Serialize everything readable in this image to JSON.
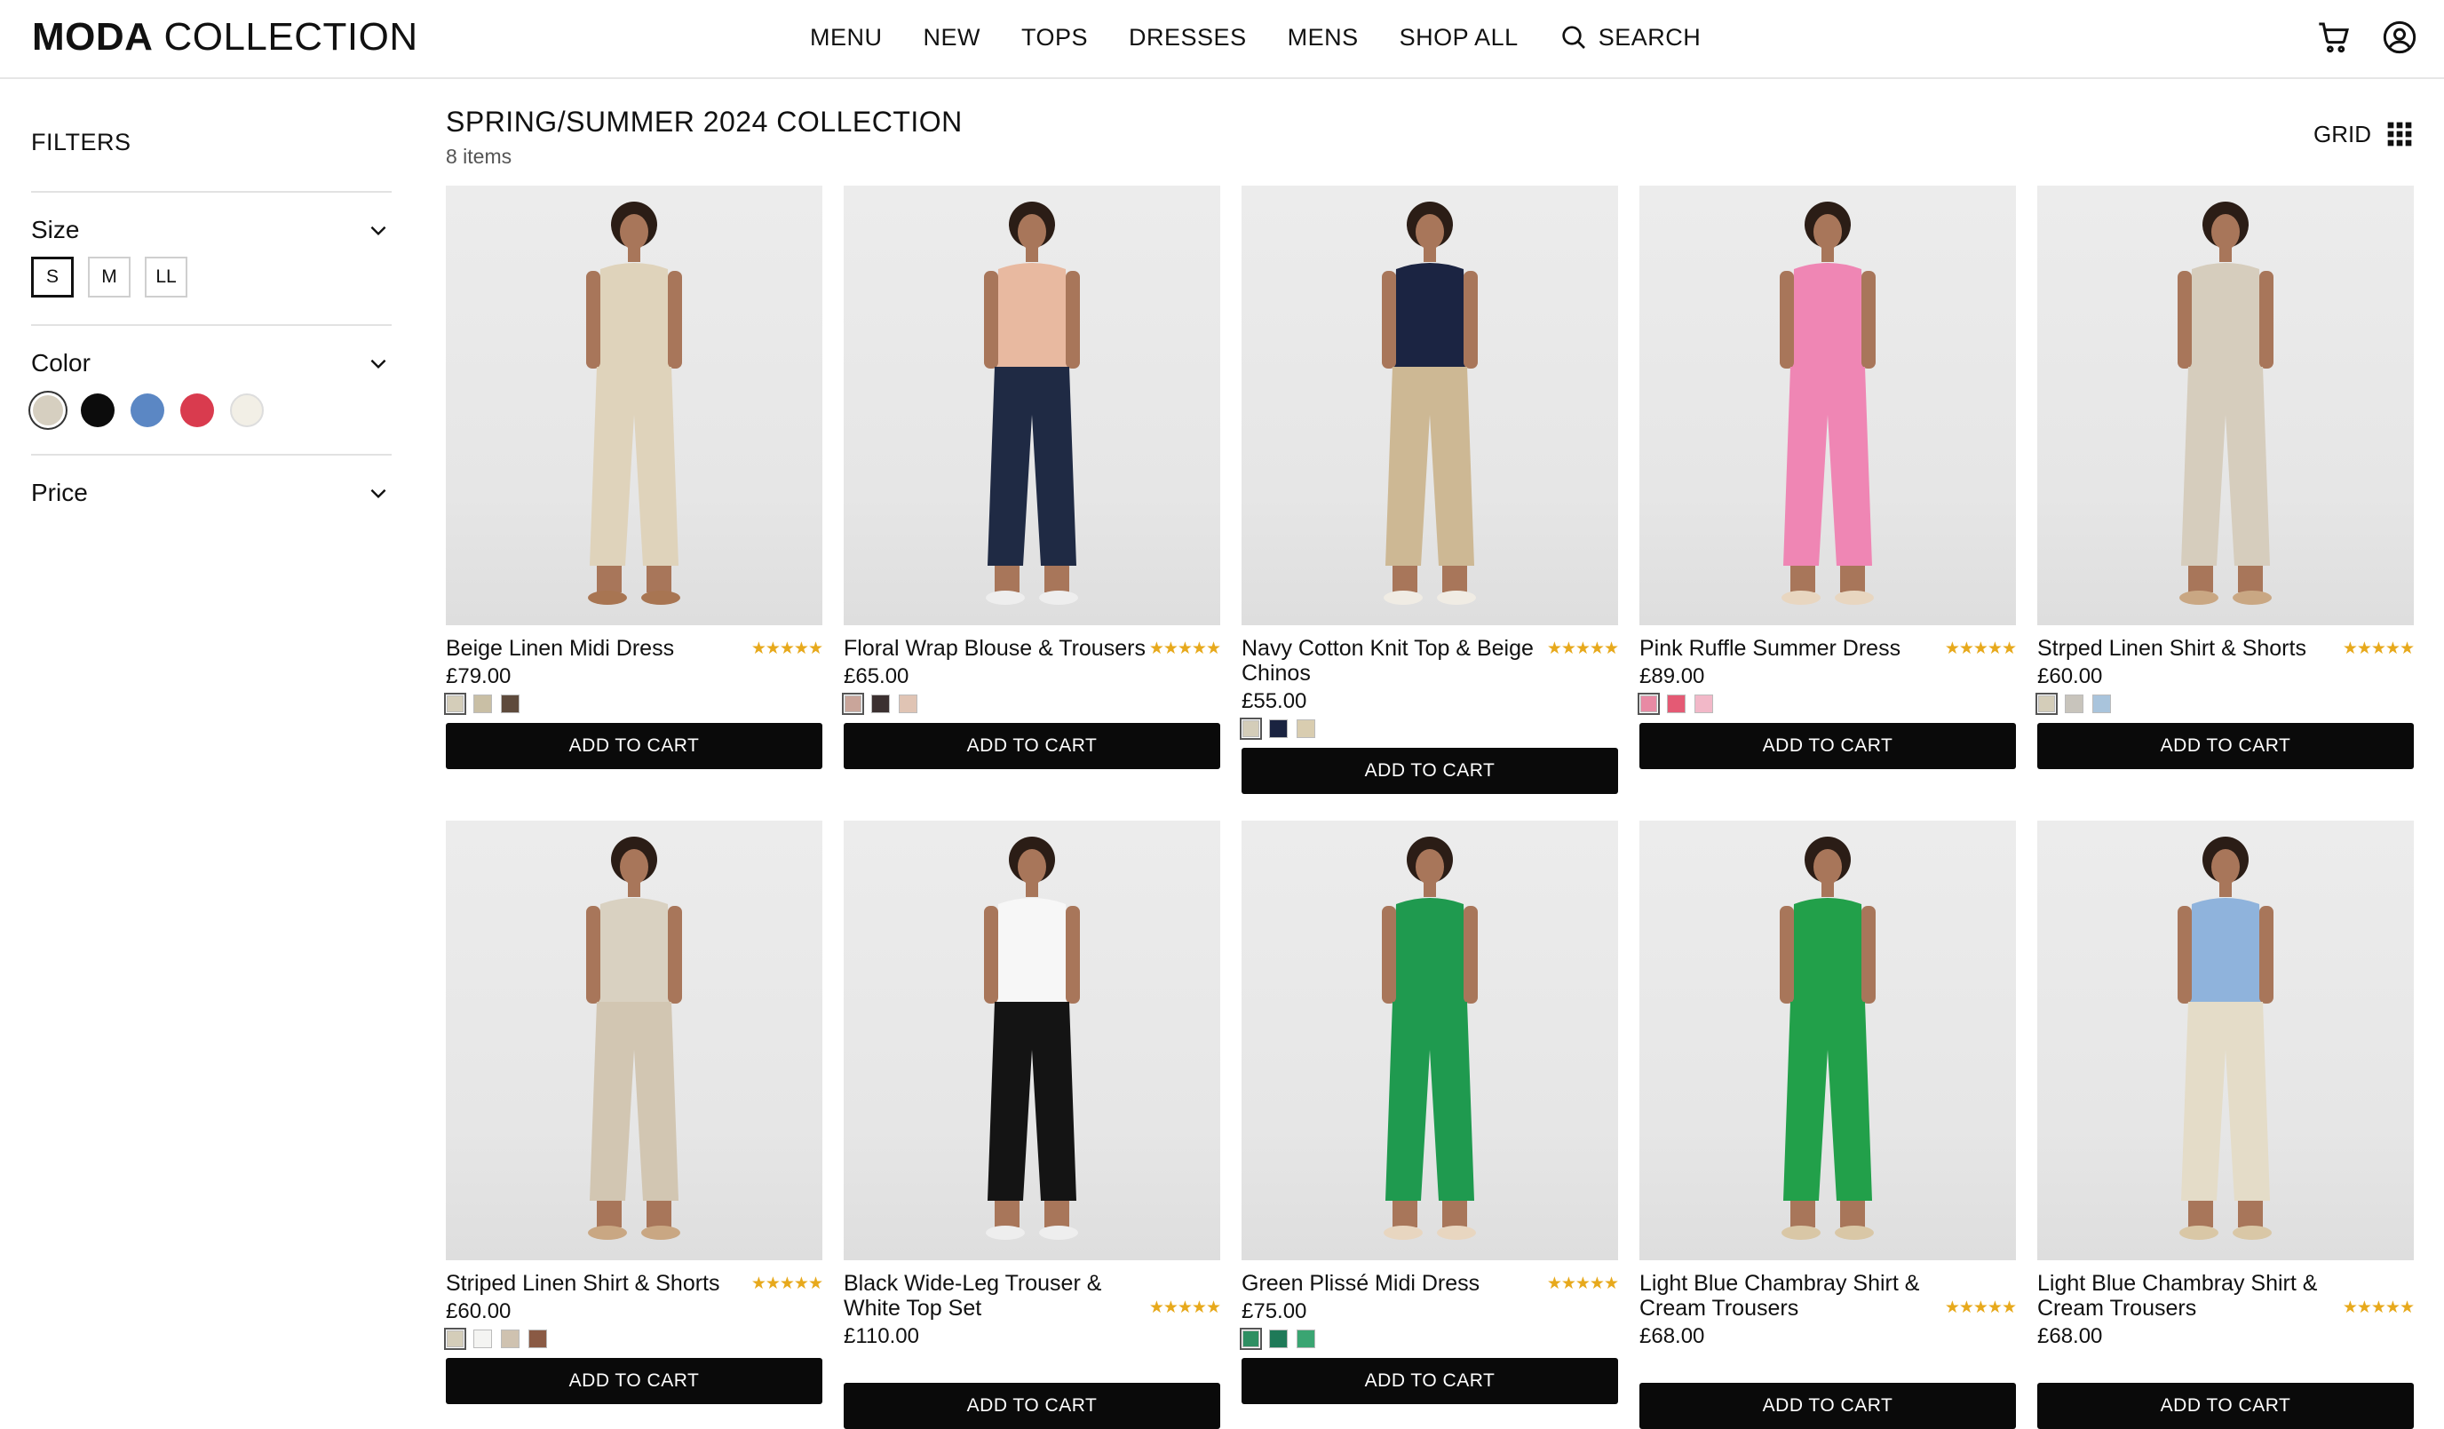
{
  "header": {
    "logo_bold": "MODA",
    "logo_regular": "COLLECTION",
    "nav": [
      "MENU",
      "NEW",
      "TOPS",
      "DRESSES",
      "MENS",
      "SHOP ALL"
    ],
    "search_label": "SEARCH",
    "icons": [
      "search-icon",
      "cart-icon",
      "account-icon"
    ]
  },
  "sidebar": {
    "title": "FILTERS",
    "size_label": "Size",
    "sizes": [
      "S",
      "M",
      "LL"
    ],
    "selected_size": "S",
    "color_label": "Color",
    "colors": [
      "#d6cfc0",
      "#0c0c0c",
      "#5b87c4",
      "#d93b4e",
      "#f2efe6"
    ],
    "selected_color": "#d6cfc0",
    "price_label": "Price"
  },
  "main": {
    "title": "SPRING/SUMMER 2024 COLLECTION",
    "count": "8 items",
    "view_label": "GRID",
    "cart_label": "ADD TO CART",
    "rating_stars": "★★★★★",
    "products": [
      {
        "name": "Beige Linen Midi Dress",
        "price": "£79.00",
        "rating": 5,
        "swatches": [
          "#d4cdb9",
          "#c9bfa5",
          "#5e4a3c"
        ],
        "top": "#dfd3bb",
        "bottom": "#dfd3bb",
        "shoes": "#a87552"
      },
      {
        "name": "Floral Wrap Blouse & Trousers",
        "price": "£65.00",
        "rating": 5,
        "swatches": [
          "#c9a59a",
          "#3b3030",
          "#e0c4b4"
        ],
        "top": "#e8b9a0",
        "bottom": "#1f2a44",
        "shoes": "#eeeeee"
      },
      {
        "name": "Navy Cotton Knit Top & Beige Chinos",
        "price": "£55.00",
        "rating": 5,
        "swatches": [
          "#d4cdb9",
          "#1a2340",
          "#d9cdb0"
        ],
        "top": "#1b2442",
        "bottom": "#cdb894",
        "shoes": "#f0ece4"
      },
      {
        "name": "Pink Ruffle Summer Dress",
        "price": "£89.00",
        "rating": 5,
        "swatches": [
          "#e88aa4",
          "#e45a74",
          "#f2b8c8"
        ],
        "top": "#ef86b4",
        "bottom": "#ef86b4",
        "shoes": "#e8d6c0"
      },
      {
        "name": "Strped Linen Shirt & Shorts",
        "price": "£60.00",
        "rating": 5,
        "swatches": [
          "#d4cdb9",
          "#c8c4bc",
          "#a9c4dc"
        ],
        "top": "#d6cdbd",
        "bottom": "#d6cdbd",
        "shoes": "#c9a783"
      },
      {
        "name": "Striped Linen Shirt & Shorts",
        "price": "£60.00",
        "rating": 5,
        "swatches": [
          "#d4cdb9",
          "#f4f4f2",
          "#cfc2b0",
          "#8a5a44"
        ],
        "top": "#d9d1c1",
        "bottom": "#d2c6b2",
        "shoes": "#c9a783"
      },
      {
        "name": "Black Wide-Leg Trouser & White Top Set",
        "price": "£110.00",
        "rating": 5,
        "swatches": [],
        "top": "#f7f7f7",
        "bottom": "#141414",
        "shoes": "#eeeeee"
      },
      {
        "name": "Green Plissé Midi Dress",
        "price": "£75.00",
        "rating": 5,
        "swatches": [
          "#2e8f62",
          "#1f7a58",
          "#3aa572"
        ],
        "top": "#1f9a4f",
        "bottom": "#1f9a4f",
        "shoes": "#e8d6c0"
      },
      {
        "name": "Light Blue Chambray Shirt & Cream Trousers",
        "price": "£68.00",
        "rating": 5,
        "swatches": [],
        "top": "#22a04a",
        "bottom": "#22a04a",
        "shoes": "#d9c7a6"
      },
      {
        "name": "Light Blue Chambray Shirt & Cream Trousers",
        "price": "£68.00",
        "rating": 5,
        "swatches": [],
        "top": "#8fb3dc",
        "bottom": "#e4dcc8",
        "shoes": "#d9c7a6"
      }
    ]
  }
}
